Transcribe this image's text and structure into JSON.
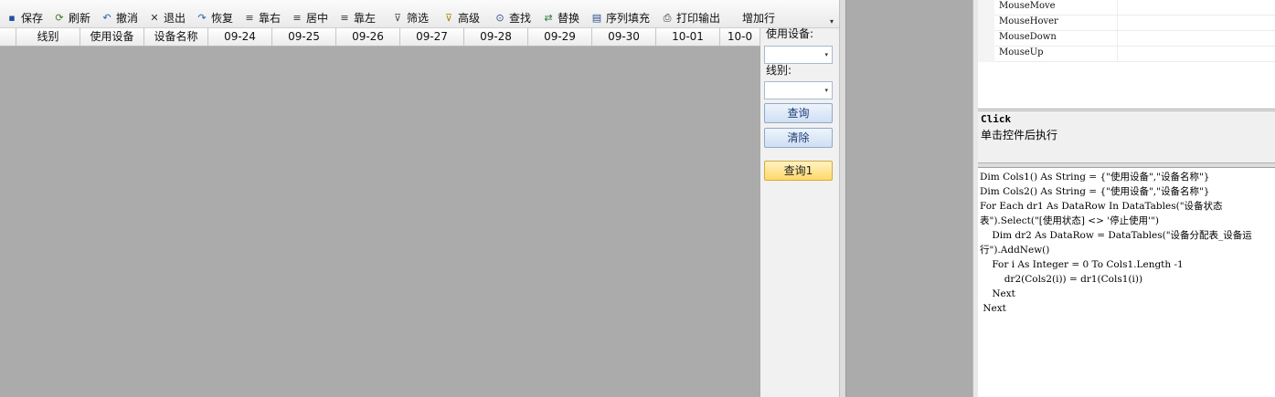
{
  "toolbar": {
    "buttons": [
      {
        "label": "保存",
        "icon": "save-icon",
        "glyph": "▪",
        "color": "#1f4fa3"
      },
      {
        "label": "刷新",
        "icon": "refresh-icon",
        "glyph": "⟳",
        "color": "#3f7a2a"
      },
      {
        "label": "撤消",
        "icon": "undo-icon",
        "glyph": "↶",
        "color": "#2a5fb0"
      },
      {
        "label": "退出",
        "icon": "close-icon",
        "glyph": "✕",
        "color": "#333333"
      },
      {
        "label": "恢复",
        "icon": "redo-icon",
        "glyph": "↷",
        "color": "#2a5fb0"
      },
      {
        "label": "靠右",
        "icon": "align-right-icon",
        "glyph": "≡",
        "color": "#333333"
      },
      {
        "label": "居中",
        "icon": "align-center-icon",
        "glyph": "≡",
        "color": "#333333"
      },
      {
        "label": "靠左",
        "icon": "align-left-icon",
        "glyph": "≡",
        "color": "#333333"
      },
      {
        "label": "筛选",
        "icon": "filter-icon",
        "glyph": "⊽",
        "color": "#555555"
      },
      {
        "label": "高级",
        "icon": "advanced-filter-icon",
        "glyph": "⊽",
        "color": "#b08a12"
      },
      {
        "label": "查找",
        "icon": "binoculars-icon",
        "glyph": "⊙",
        "color": "#2a4f8a"
      },
      {
        "label": "替换",
        "icon": "replace-icon",
        "glyph": "⇄",
        "color": "#2a7a3a"
      },
      {
        "label": "序列填充",
        "icon": "fill-series-icon",
        "glyph": "▤",
        "color": "#2a4f8a"
      },
      {
        "label": "打印输出",
        "icon": "printer-icon",
        "glyph": "⎙",
        "color": "#333333"
      },
      {
        "label": "增加行",
        "icon": "",
        "glyph": "",
        "color": "#333333"
      }
    ],
    "scroll_glyph": "▾"
  },
  "grid": {
    "columns": [
      "线别",
      "使用设备",
      "设备名称",
      "09-24",
      "09-25",
      "09-26",
      "09-27",
      "09-28",
      "09-29",
      "09-30",
      "10-01",
      "10-0"
    ]
  },
  "side_panel": {
    "device_label": "使用设备:",
    "line_label": "线别:",
    "query_label": "查询",
    "clear_label": "清除",
    "query1_label": "查询1",
    "combo_arrow": "▾"
  },
  "properties": {
    "events": [
      "MouseMove",
      "MouseHover",
      "MouseDown",
      "MouseUp"
    ]
  },
  "description": {
    "title": "Click",
    "text": "单击控件后执行"
  },
  "code": {
    "lines": [
      "Dim Cols1() As String = {\"使用设备\",\"设备名称\"}",
      "Dim Cols2() As String = {\"使用设备\",\"设备名称\"}",
      "For Each dr1 As DataRow In DataTables(\"设备状态",
      "表\").Select(\"[使用状态] <> '停止使用'\")",
      "    Dim dr2 As DataRow = DataTables(\"设备分配表_设备运",
      "行\").AddNew()",
      "    For i As Integer = 0 To Cols1.Length -1",
      "        dr2(Cols2(i)) = dr1(Cols1(i))",
      "    Next",
      " Next"
    ]
  }
}
